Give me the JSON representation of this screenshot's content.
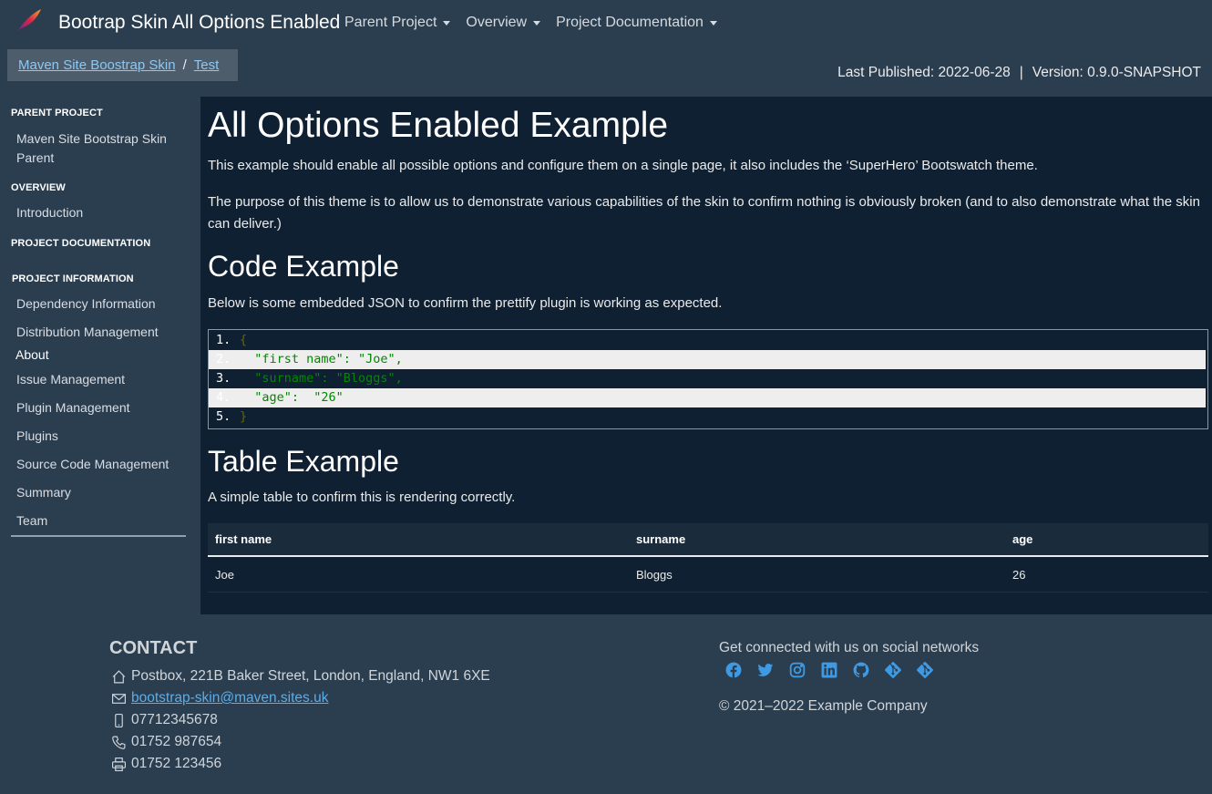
{
  "navbar": {
    "brand_title": "Bootrap Skin All Options Enabled",
    "menu": [
      "Parent Project",
      "Overview",
      "Project Documentation"
    ]
  },
  "breadcrumb": {
    "items": [
      "Maven Site Boostrap Skin",
      "Test"
    ],
    "separator": "/"
  },
  "publish": {
    "last_published": "Last Published: 2022-06-28",
    "separator": "|",
    "version": "Version: 0.9.0-SNAPSHOT"
  },
  "sidebar": {
    "parent_project_header": "PARENT PROJECT",
    "parent_link": "Maven Site Bootstrap Skin",
    "parent_link_2": "Parent",
    "overview_header": "OVERVIEW",
    "introduction": "Introduction",
    "project_documentation_header": "PROJECT DOCUMENTATION",
    "project_information_header": "PROJECT INFORMATION",
    "items": [
      "Dependency Information",
      "Distribution Management",
      "About",
      "Issue Management",
      "Plugin Management",
      "Plugins",
      "Source Code Management",
      "Summary",
      "Team"
    ]
  },
  "main": {
    "title": "All Options Enabled Example",
    "intro": "This example should enable all possible options and configure them on a single page, it also includes the ‘SuperHero’ Bootswatch theme.",
    "purpose": "The purpose of this theme is to allow us to demonstrate various capabilities of the skin to confirm nothing is obviously broken (and to also demonstrate what the skin can deliver.)",
    "code_heading": "Code Example",
    "code_text": "Below is some embedded JSON to confirm the prettify plugin is working as expected.",
    "code_lines": [
      {
        "num": "1.",
        "text": "{"
      },
      {
        "num": "2.",
        "text": "  \"first name\": \"Joe\","
      },
      {
        "num": "3.",
        "text": "  \"surname\": \"Bloggs\","
      },
      {
        "num": "4.",
        "text": "  \"age\":  \"26\""
      },
      {
        "num": "5.",
        "text": "}"
      }
    ],
    "table_heading": "Table Example",
    "table_text": "A simple table to confirm this is rendering correctly.",
    "table": {
      "headers": [
        "first name",
        "surname",
        "age"
      ],
      "rows": [
        [
          "Joe",
          "Bloggs",
          "26"
        ]
      ]
    }
  },
  "footer": {
    "contact_title": "CONTACT",
    "address": "Postbox, 221B Baker Street, London, England, NW1 6XE",
    "email": "bootstrap-skin@maven.sites.uk",
    "mobile": "07712345678",
    "phone": "01752 987654",
    "fax": "01752 123456",
    "social_text": "Get connected with us on social networks",
    "social_icons": [
      "facebook-icon",
      "twitter-icon",
      "instagram-icon",
      "linkedin-icon",
      "github-icon",
      "git-icon",
      "git-icon"
    ],
    "copyright": "© 2021–2022 Example Company"
  },
  "colors": {
    "page_bg": "#2b3e50",
    "main_bg": "#0f2032",
    "link": "#5aaeea",
    "breadcrumb_bg": "#4e5d6c",
    "code_string": "#008800",
    "code_punctuation": "#666600"
  }
}
